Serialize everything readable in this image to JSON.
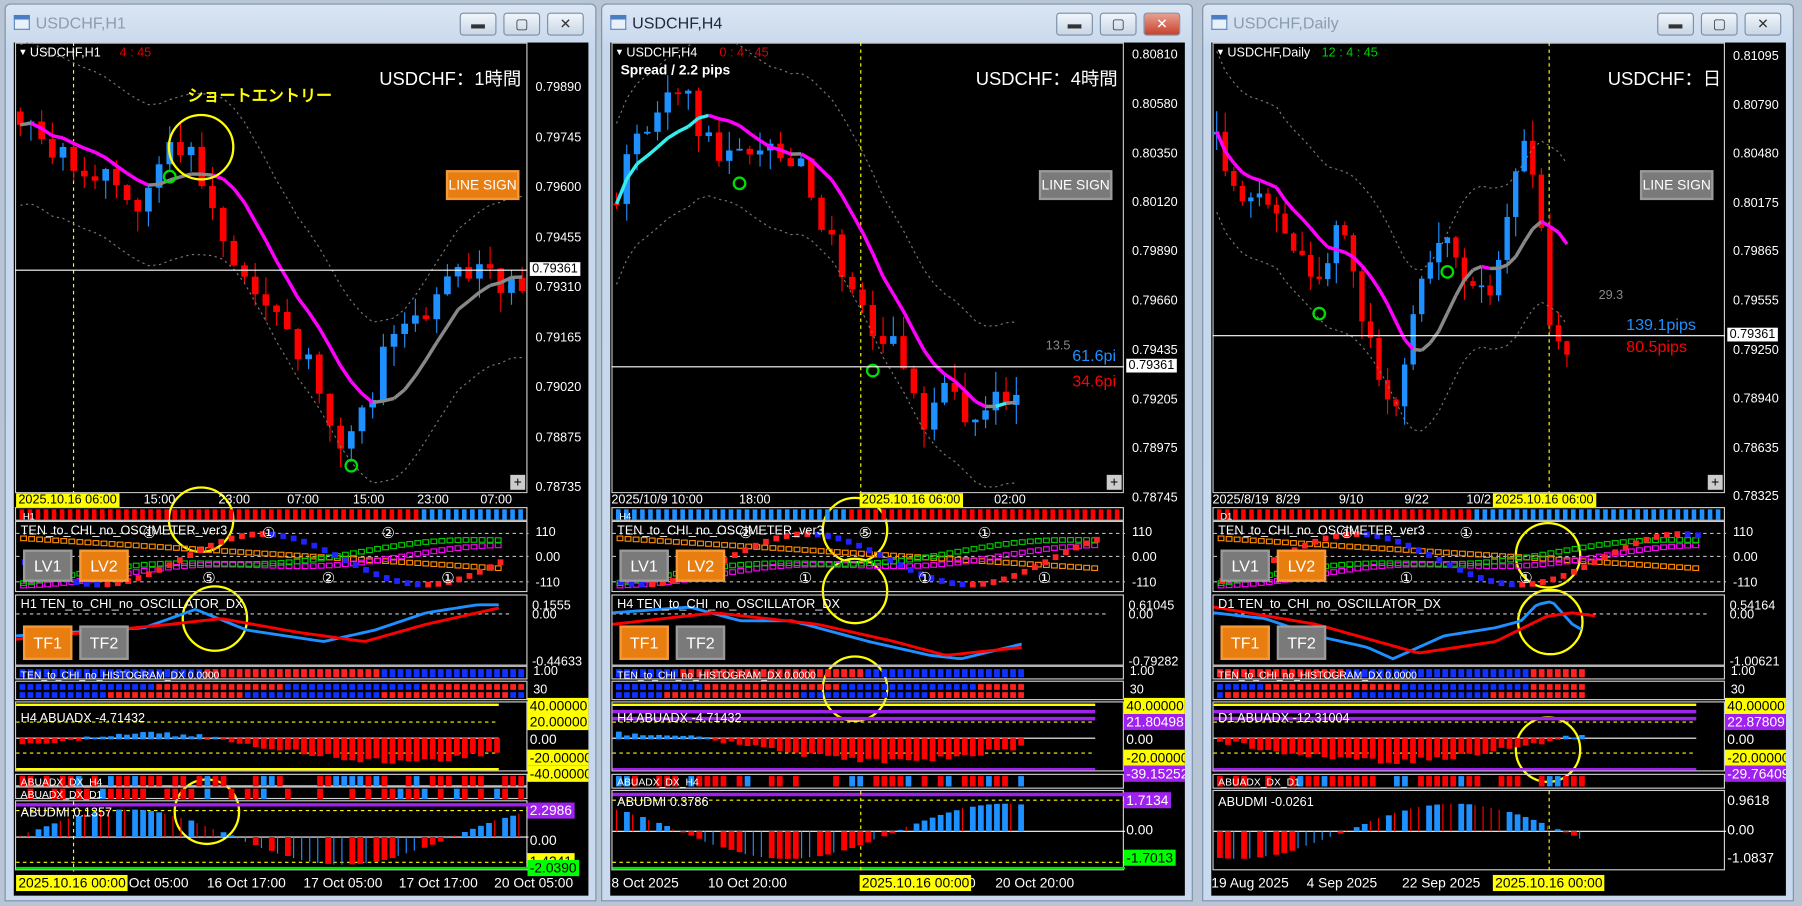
{
  "windows": [
    {
      "title": "USDCHF,H1",
      "symbol_label": "USDCHF,H1",
      "timer": "4 : 45",
      "timer_color": "#e00000",
      "header": "USDCHF：1時間",
      "annotation": "ショートエントリー",
      "spread": null,
      "line_sign": "LINE SIGN",
      "line_sign_color": "#e87d10",
      "price_ticks": [
        "0.79890",
        "0.79745",
        "0.79600",
        "0.79455",
        "0.79310",
        "0.79165",
        "0.79020",
        "0.78875",
        "0.78735"
      ],
      "current_price": "0.79361",
      "time_labels": [
        "15:00",
        "23:00",
        "07:00",
        "15:00",
        "23:00",
        "07:00"
      ],
      "crosshair_time": "2025.10.16 06:00",
      "bottom_time_labels": [
        "Oct 05:00",
        "16 Oct 17:00",
        "17 Oct 05:00",
        "17 Oct 17:00",
        "20 Oct 05:00"
      ],
      "bottom_crosshair": "2025.10.16 00:00",
      "pips": null,
      "panels": {
        "bar_label": "H1",
        "osc": {
          "name": "TEN_to_CHI_no_OSCIMETER_ver3",
          "levels": [
            "110",
            "0.00",
            "-110"
          ],
          "lv1": "LV1",
          "lv2": "LV2",
          "markers": [
            "①",
            "⑤",
            "①",
            "②",
            "②",
            "①"
          ]
        },
        "dx": {
          "name": "H1 TEN_to_CHI_no_OSCILLATOR_DX",
          "levels": [
            "0.1555",
            "0.00",
            "-0.44633"
          ],
          "tf1": "TF1",
          "tf2": "TF2"
        },
        "hist": {
          "name": "TEN_to_CHI_no_HISTOGRAM_DX 0.0000",
          "level": "1.00"
        },
        "dbl": {
          "level": "30"
        },
        "adx": {
          "name": "H4 ABUADX  -4.71432",
          "levels": [
            "40.00000",
            "20.00000",
            "0.00",
            "-20.00000",
            "-40.00000"
          ]
        },
        "dx_strips": [
          "ABUADX_DX_H4",
          "ABUADX_DX_D1"
        ],
        "dmi": {
          "name": "ABUDMI  0.1357",
          "levels": [
            "2.2986",
            "0.00",
            "1.4241",
            "-2.0390"
          ]
        }
      }
    },
    {
      "title": "USDCHF,H4",
      "symbol_label": "USDCHF,H4",
      "timer": "0 : 4 : 45",
      "timer_color": "#e00000",
      "header": "USDCHF：4時間",
      "annotation": null,
      "spread": "Spread / 2.2 pips",
      "line_sign": "LINE SIGN",
      "line_sign_color": "#777777",
      "price_ticks": [
        "0.80810",
        "0.80580",
        "0.80350",
        "0.80120",
        "0.79890",
        "0.79660",
        "0.79435",
        "0.79205",
        "0.78975",
        "0.78745"
      ],
      "current_price": "0.79361",
      "time_labels": [
        "2025/10/9 10:00",
        "18:00",
        "18:00",
        "02:00"
      ],
      "crosshair_time": "2025.10.16 06:00",
      "bottom_time_labels": [
        "8 Oct 2025",
        "10 Oct 20:00",
        "Oct 20:00",
        "20 Oct 20:00"
      ],
      "bottom_crosshair": "2025.10.16 00:00",
      "pips": {
        "range": "13.5",
        "up": "61.6pi",
        "down": "34.6pi"
      },
      "panels": {
        "bar_label": "H4",
        "osc": {
          "name": "TEN_to_CHI_no_OSCIMETER_ver3",
          "levels": [
            "110",
            "0.00",
            "-110"
          ],
          "lv1": "LV1",
          "lv2": "LV2",
          "markers": [
            "②",
            "①",
            "⑤",
            "①",
            "①",
            "①"
          ]
        },
        "dx": {
          "name": "H4 TEN_to_CHI_no_OSCILLATOR_DX",
          "levels": [
            "0.61045",
            "0.00",
            "-0.79282"
          ],
          "tf1": "TF1",
          "tf2": "TF2"
        },
        "hist": {
          "name": "TEN_to_CHI_no_HISTOGRAM_DX 0.0000",
          "level": "1.00"
        },
        "dbl": {
          "level": "30"
        },
        "adx": {
          "name": "H4 ABUADX  -4.71432",
          "levels": [
            "40.00000",
            "21.80498",
            "0.00",
            "-20.00000",
            "-39.15252"
          ]
        },
        "dx_strips": [
          "ABUADX_DX_H4"
        ],
        "dmi": {
          "name": "ABUDMI  0.3786",
          "levels": [
            "1.7134",
            "0.00",
            "-1.7013"
          ]
        }
      }
    },
    {
      "title": "USDCHF,Daily",
      "symbol_label": "USDCHF,Daily",
      "timer": "12 : 4 : 45",
      "timer_color": "#00d000",
      "header": "USDCHF：日",
      "annotation": null,
      "spread": null,
      "line_sign": "LINE SIGN",
      "line_sign_color": "#777777",
      "price_ticks": [
        "0.81095",
        "0.80790",
        "0.80480",
        "0.80175",
        "0.79865",
        "0.79555",
        "0.79250",
        "0.78940",
        "0.78635",
        "0.78325"
      ],
      "current_price": "0.79361",
      "time_labels": [
        "2025/8/19",
        "8/29",
        "9/10",
        "9/22",
        "10/2"
      ],
      "crosshair_time": "2025.10.16 06:00",
      "bottom_time_labels": [
        "19 Aug 2025",
        "4 Sep 2025",
        "22 Sep 2025"
      ],
      "bottom_crosshair": "2025.10.16 00:00",
      "pips": {
        "range": "29.3",
        "up": "139.1pips",
        "down": "80.5pips"
      },
      "panels": {
        "bar_label": "D1",
        "osc": {
          "name": "TEN_to_CHI_no_OSCIMETER_ver3",
          "levels": [
            "110",
            "0.00",
            "-110"
          ],
          "lv1": "LV1",
          "lv2": "LV2",
          "markers": [
            "①",
            "①",
            "①",
            "①"
          ]
        },
        "dx": {
          "name": "D1 TEN_to_CHI_no_OSCILLATOR_DX",
          "levels": [
            "0.54164",
            "0.00",
            "-1.00621"
          ],
          "tf1": "TF1",
          "tf2": "TF2"
        },
        "hist": {
          "name": "TEN_to_CHI_no_HISTOGRAM_DX 0.0000",
          "level": "1.00"
        },
        "dbl": {
          "level": "30"
        },
        "adx": {
          "name": "D1 ABUADX  -12.31004",
          "levels": [
            "40.00000",
            "22.87809",
            "0.00",
            "-20.00000",
            "-29.76409"
          ]
        },
        "dx_strips": [
          "ABUADX_DX_D1"
        ],
        "dmi": {
          "name": "ABUDMI  -0.0261",
          "levels": [
            "0.9618",
            "0.00",
            "-1.0837"
          ]
        }
      }
    }
  ],
  "colors": {
    "up": "#1e90ff",
    "down": "#ff0000",
    "highlight": "#ffff00",
    "ma_down": "#ff00ff",
    "ma_up": "#33eeee"
  }
}
